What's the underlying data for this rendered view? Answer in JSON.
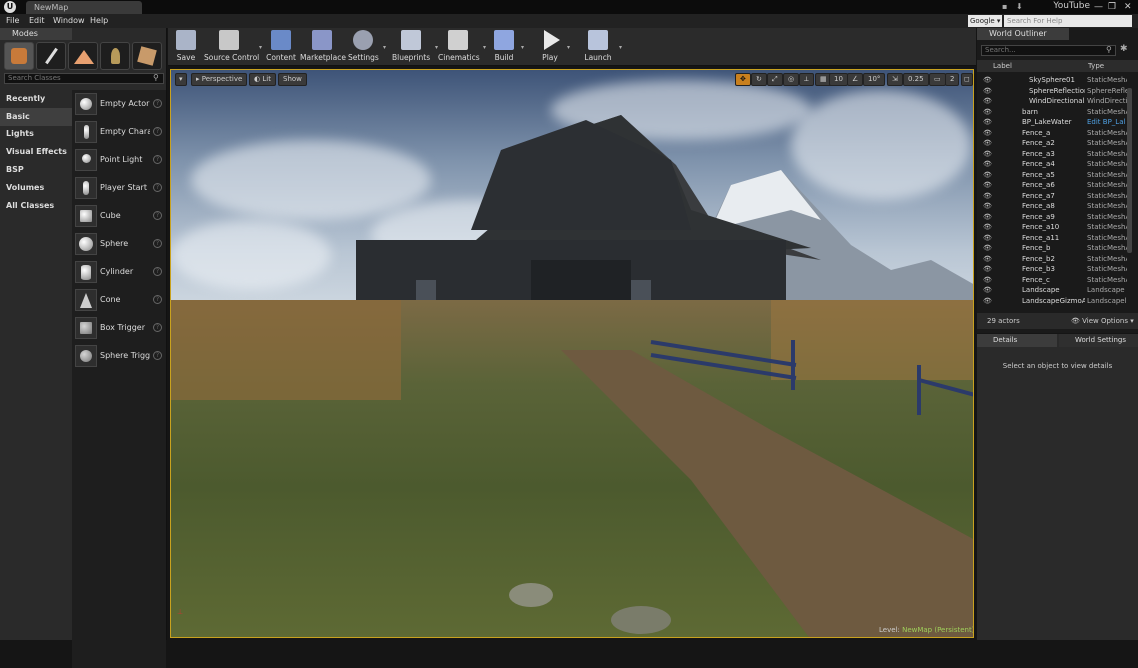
{
  "titlebar": {
    "tab": "NewMap",
    "account": "YouTube",
    "controls": [
      "—",
      "❐",
      "✕"
    ]
  },
  "menu": [
    "File",
    "Edit",
    "Window",
    "Help"
  ],
  "helpsearch": {
    "engine": "Google",
    "placeholder": "Search For Help"
  },
  "modes": {
    "title": "Modes",
    "search_placeholder": "Search Classes",
    "categories": [
      "Recently Placed",
      "Basic",
      "Lights",
      "Visual Effects",
      "BSP",
      "Volumes",
      "All Classes"
    ],
    "selected_category": "Basic",
    "items": [
      "Empty Actor",
      "Empty Charac",
      "Point Light",
      "Player Start",
      "Cube",
      "Sphere",
      "Cylinder",
      "Cone",
      "Box Trigger",
      "Sphere Trigge"
    ]
  },
  "toolbar": [
    "Save",
    "Source Control",
    "Content",
    "Marketplace",
    "Settings",
    "Blueprints",
    "Cinematics",
    "Build",
    "Play",
    "Launch"
  ],
  "viewport": {
    "view_mode": "Perspective",
    "lit": "Lit",
    "show": "Show",
    "grid_snap": "10",
    "rot_snap": "10°",
    "scale_snap": "0.25",
    "cam_speed": "2",
    "level_label": "Level:",
    "level_name": "NewMap (Persistent)"
  },
  "outliner": {
    "title": "World Outliner",
    "search_placeholder": "Search...",
    "col_label": "Label",
    "col_type": "Type",
    "rows": [
      {
        "label": "SkySphere01",
        "type": "StaticMeshA"
      },
      {
        "label": "SphereReflection",
        "type": "SphereRefle"
      },
      {
        "label": "WindDirectionalS",
        "type": "WindDirecti"
      },
      {
        "label": "barn",
        "type": "StaticMeshA"
      },
      {
        "label": "BP_LakeWater",
        "type": "Edit BP_Lal"
      },
      {
        "label": "Fence_a",
        "type": "StaticMeshA"
      },
      {
        "label": "Fence_a2",
        "type": "StaticMeshA"
      },
      {
        "label": "Fence_a3",
        "type": "StaticMeshA"
      },
      {
        "label": "Fence_a4",
        "type": "StaticMeshA"
      },
      {
        "label": "Fence_a5",
        "type": "StaticMeshA"
      },
      {
        "label": "Fence_a6",
        "type": "StaticMeshA"
      },
      {
        "label": "Fence_a7",
        "type": "StaticMeshA"
      },
      {
        "label": "Fence_a8",
        "type": "StaticMeshA"
      },
      {
        "label": "Fence_a9",
        "type": "StaticMeshA"
      },
      {
        "label": "Fence_a10",
        "type": "StaticMeshA"
      },
      {
        "label": "Fence_a11",
        "type": "StaticMeshA"
      },
      {
        "label": "Fence_b",
        "type": "StaticMeshA"
      },
      {
        "label": "Fence_b2",
        "type": "StaticMeshA"
      },
      {
        "label": "Fence_b3",
        "type": "StaticMeshA"
      },
      {
        "label": "Fence_c",
        "type": "StaticMeshA"
      },
      {
        "label": "Landscape",
        "type": "Landscape"
      },
      {
        "label": "LandscapeGizmoAct",
        "type": "Landscapeli"
      }
    ],
    "actor_count": "29 actors",
    "view_options": "View Options"
  },
  "details": {
    "tab_details": "Details",
    "tab_world": "World Settings",
    "empty_message": "Select an object to view details"
  },
  "colors": {
    "accent": "#c9a21e",
    "panel": "#2a2a2a",
    "dark": "#1a1a1a"
  }
}
